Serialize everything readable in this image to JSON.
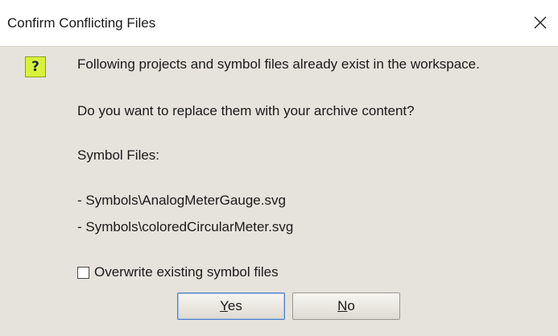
{
  "dialog": {
    "title": "Confirm Conflicting Files",
    "close_icon": "close-icon"
  },
  "message": {
    "line1": "Following projects and symbol files already exist in the workspace.",
    "line2": "Do you want to replace them with your archive content?",
    "symbol_files_heading": "Symbol Files:",
    "files": [
      "- Symbols\\AnalogMeterGauge.svg",
      "- Symbols\\coloredCircularMeter.svg"
    ]
  },
  "icon": {
    "name": "question-icon",
    "glyph": "?",
    "color": "#d8f23a"
  },
  "options": {
    "overwrite_label": "Overwrite existing symbol files",
    "overwrite_checked": false
  },
  "buttons": {
    "yes_mnemonic": "Y",
    "yes_rest": "es",
    "no_mnemonic": "N",
    "no_rest": "o"
  }
}
